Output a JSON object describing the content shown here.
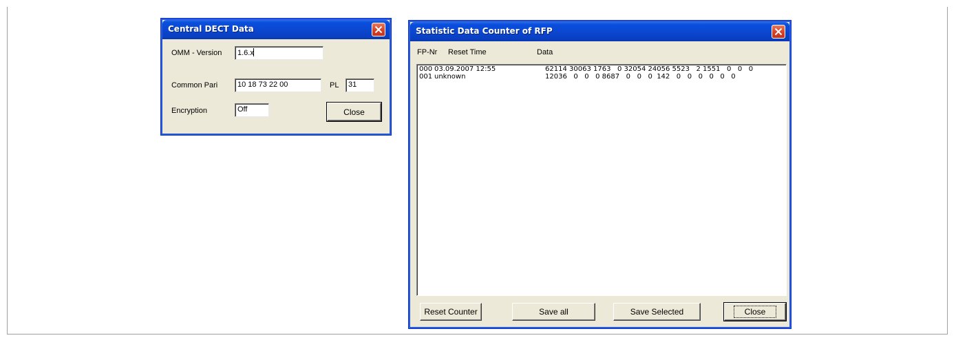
{
  "central": {
    "title": "Central DECT Data",
    "omm_label": "OMM - Version",
    "omm_value": "1.6.x",
    "pari_label": "Common Pari",
    "pari_value": "10 18 73 22 00",
    "pl_label": "PL",
    "pl_value": "31",
    "enc_label": "Encryption",
    "enc_value": "Off",
    "close_label": "Close"
  },
  "stats": {
    "title": "Statistic Data Counter of RFP",
    "headers": {
      "fp": "FP-Nr",
      "reset": "Reset Time",
      "data": "Data"
    },
    "rows": [
      {
        "fp": "000",
        "reset": "03.09.2007 12:55",
        "data": "62114 30063 1763   0 32054 24056 5523   2 1551   0   0   0"
      },
      {
        "fp": "001",
        "reset": "unknown",
        "data": "12036   0   0   0 8687   0   0   0  142   0   0   0   0   0   0"
      }
    ],
    "buttons": {
      "reset": "Reset Counter",
      "save_all": "Save all",
      "save_selected": "Save Selected",
      "close": "Close"
    }
  },
  "colors": {
    "titlebar": "#0a4fde",
    "face": "#ece9d8",
    "close_red": "#d8422a"
  }
}
